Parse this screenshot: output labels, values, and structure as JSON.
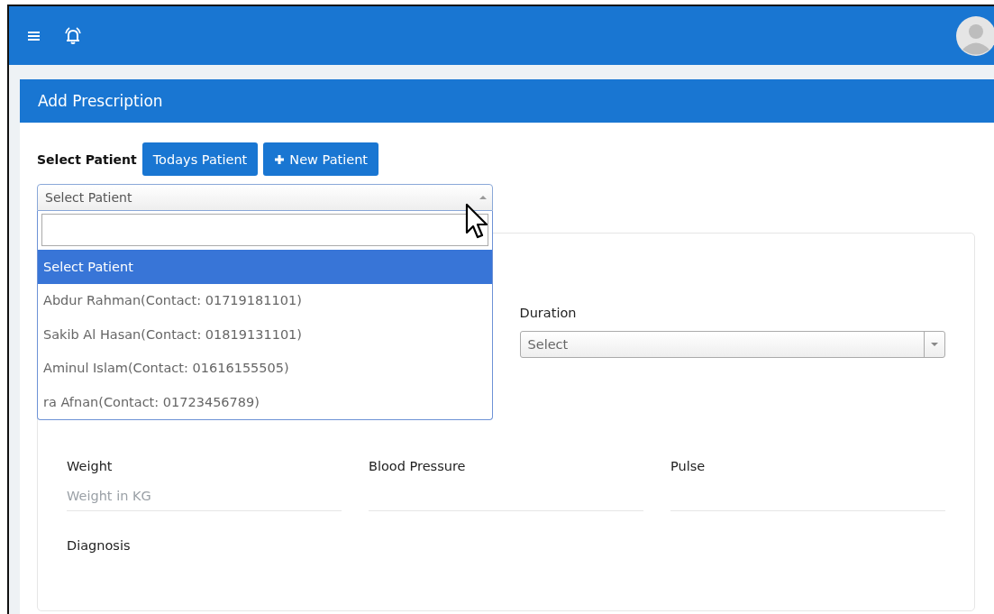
{
  "page_title": "Add Prescription",
  "patient_picker": {
    "label": "Select Patient",
    "buttons": [
      {
        "label": "Todays Patient",
        "kind": "plain"
      },
      {
        "label": "New Patient",
        "kind": "add"
      }
    ],
    "select": {
      "value": "Select Patient",
      "expanded": true,
      "options": [
        {
          "label": "Select Patient",
          "selected": true
        },
        {
          "label": "Abdur Rahman(Contact: 01719181101)",
          "selected": false
        },
        {
          "label": "Sakib Al Hasan(Contact: 01819131101)",
          "selected": false
        },
        {
          "label": "Aminul Islam(Contact: 01616155505)",
          "selected": false
        },
        {
          "label": "ra Afnan(Contact: 01723456789)",
          "selected": false
        }
      ]
    }
  },
  "duration": {
    "label": "Duration",
    "placeholder": "Select"
  },
  "vitals": [
    {
      "label": "Weight",
      "placeholder": "Weight in KG"
    },
    {
      "label": "Blood Pressure"
    },
    {
      "label": "Pulse"
    }
  ],
  "diagnosis": {
    "label": "Diagnosis"
  }
}
